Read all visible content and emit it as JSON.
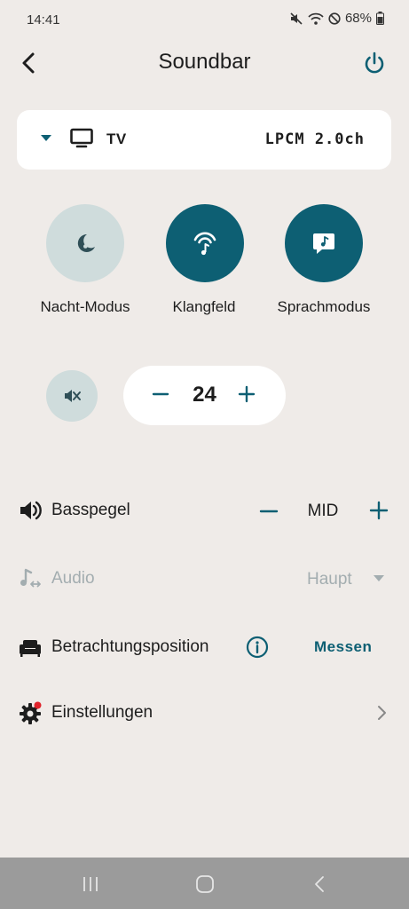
{
  "status": {
    "time": "14:41",
    "battery": "68%",
    "icons": [
      "mute-icon",
      "wifi-icon",
      "do-not-disturb-icon",
      "battery-icon"
    ]
  },
  "header": {
    "title": "Soundbar",
    "back_icon": "chevron-left-icon",
    "power_icon": "power-icon"
  },
  "source": {
    "label": "TV",
    "format": "LPCM  2.0ch"
  },
  "modes": [
    {
      "label": "Nacht-Modus",
      "icon": "moon-note-icon",
      "active": false
    },
    {
      "label": "Klangfeld",
      "icon": "sound-field-icon",
      "active": true
    },
    {
      "label": "Sprachmodus",
      "icon": "speech-bubble-note-icon",
      "active": true
    }
  ],
  "volume": {
    "value": "24"
  },
  "bass": {
    "label": "Basspegel",
    "value": "MID"
  },
  "audio": {
    "label": "Audio",
    "value": "Haupt"
  },
  "viewing": {
    "label": "Betrachtungsposition",
    "action": "Messen"
  },
  "settings": {
    "label": "Einstellungen"
  },
  "colors": {
    "accent": "#0d5f73",
    "inactive": "#cfdcdc",
    "background": "#efebe8",
    "notification_dot": "#e0232b"
  }
}
